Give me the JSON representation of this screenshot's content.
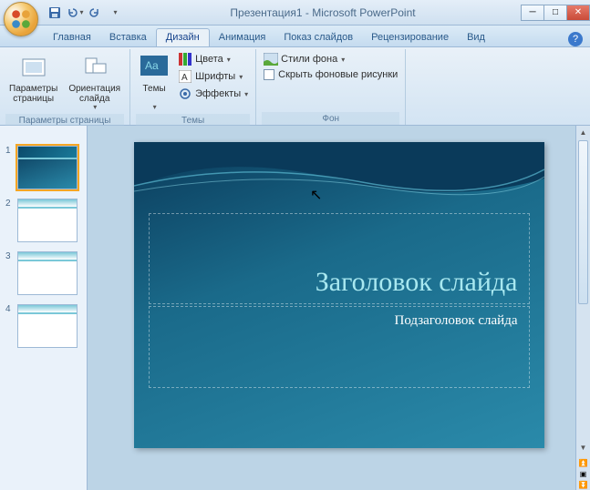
{
  "title": "Презентация1 - Microsoft PowerPoint",
  "qat": {
    "save": "save-icon",
    "undo": "undo-icon",
    "redo": "redo-icon"
  },
  "tabs": [
    "Главная",
    "Вставка",
    "Дизайн",
    "Анимация",
    "Показ слайдов",
    "Рецензирование",
    "Вид"
  ],
  "active_tab": "Дизайн",
  "ribbon": {
    "group1": {
      "label": "Параметры страницы",
      "page_setup": "Параметры\nстраницы",
      "orientation": "Ориентация\nслайда"
    },
    "group2": {
      "label": "Темы",
      "themes": "Темы",
      "colors": "Цвета",
      "fonts": "Шрифты",
      "effects": "Эффекты"
    },
    "group3": {
      "label": "Фон",
      "bg_styles": "Стили фона",
      "hide_bg": "Скрыть фоновые рисунки"
    }
  },
  "slides": [
    1,
    2,
    3,
    4
  ],
  "selected_slide": 1,
  "slide_content": {
    "title_placeholder": "Заголовок слайда",
    "subtitle_placeholder": "Подзаголовок слайда"
  },
  "colors": {
    "accent": "#3b79cc",
    "slide_bg_start": "#0a3a5a",
    "slide_bg_end": "#2a8aaa"
  }
}
